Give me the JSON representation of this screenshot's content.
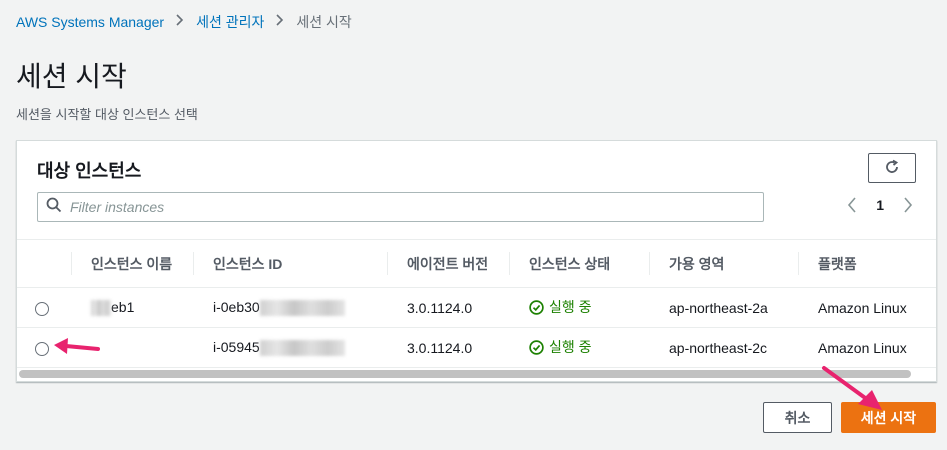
{
  "breadcrumb": {
    "items": [
      "AWS Systems Manager",
      "세션 관리자",
      "세션 시작"
    ]
  },
  "page": {
    "title": "세션 시작",
    "description": "세션을 시작할 대상 인스턴스 선택"
  },
  "panel": {
    "title": "대상 인스턴스",
    "search_placeholder": "Filter instances",
    "page_number": "1"
  },
  "table": {
    "columns": [
      "인스턴스 이름",
      "인스턴스 ID",
      "에이전트 버전",
      "인스턴스 상태",
      "가용 영역",
      "플랫폼"
    ],
    "rows": [
      {
        "name": "eb1",
        "id": "i-0eb30",
        "agent": "3.0.1124.0",
        "state": "실행 중",
        "az": "ap-northeast-2a",
        "platform": "Amazon Linux"
      },
      {
        "name": "",
        "id": "i-05945",
        "agent": "3.0.1124.0",
        "state": "실행 중",
        "az": "ap-northeast-2c",
        "platform": "Amazon Linux"
      }
    ]
  },
  "actions": {
    "cancel": "취소",
    "start": "세션 시작"
  },
  "colors": {
    "link": "#0073bb",
    "primary": "#ec7211",
    "success": "#1d8102",
    "annotation_arrow": "#e8236e"
  },
  "icons": {
    "refresh": "refresh-icon",
    "search": "search-icon",
    "prev": "chevron-left-icon",
    "next": "chevron-right-icon",
    "status": "check-circle-icon"
  }
}
